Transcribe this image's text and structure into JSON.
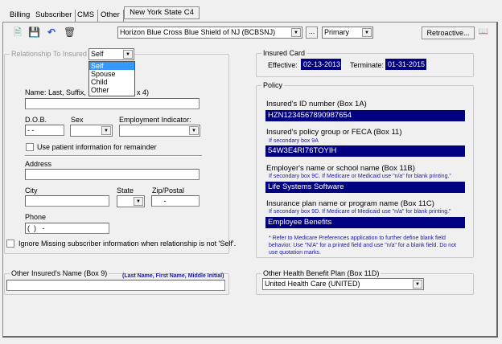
{
  "tabs": [
    {
      "label": "Billing"
    },
    {
      "label": "Subscriber"
    },
    {
      "label": "CMS"
    },
    {
      "label": "Other"
    }
  ],
  "tab_button": "New York State C4",
  "toolbar": {
    "icons": [
      "new-icon",
      "save-icon",
      "undo-icon",
      "delete-icon"
    ],
    "payer": "Horizon Blue Cross Blue Shield of NJ (BCBSNJ)",
    "browse_label": "...",
    "priority": "Primary",
    "retroactive_label": "Retroactive...",
    "copy_icon": "copy-icon"
  },
  "relationship": {
    "legend": "Relationship To Insured",
    "value": "Self",
    "options": [
      "Self",
      "Spouse",
      "Child",
      "Other"
    ]
  },
  "subscriber": {
    "name_label": "Name: Last, Suffix, F",
    "name_label_tail": "x 4)",
    "name": "",
    "dob_label": "D.O.B.",
    "dob": " - -",
    "sex_label": "Sex",
    "sex": "",
    "employment_label": "Employment Indicator:",
    "employment": "",
    "use_patient_label": "Use patient information for remainder",
    "address_label": "Address",
    "address": "",
    "city_label": "City",
    "city": "",
    "state_label": "State",
    "state": "",
    "zip_label": "Zip/Postal",
    "zip": "     -",
    "phone_label": "Phone",
    "phone": "(  )   -",
    "ignore_label": "Ignore Missing subscriber information when relationship is not 'Self'."
  },
  "other_insured": {
    "legend": "Other Insured's Name (Box 9)",
    "hint": "(Last Name, First Name, Middle Initial)",
    "value": ""
  },
  "insured_card": {
    "legend": "Insured Card",
    "effective_label": "Effective:",
    "effective": "02-13-2013",
    "terminate_label": "Terminate:",
    "terminate": "01-31-2015"
  },
  "policy": {
    "legend": "Policy",
    "id_label": "Insured's ID number (Box 1A)",
    "id": "HZN1234567890987654",
    "group_label": "Insured's policy group or FECA (Box 11)",
    "group_hint": "If secondary box 9A",
    "group": "54W3E4RI76TOYIH",
    "employer_label": "Employer's name or school name (Box 11B)",
    "employer_hint": "If secondary box 9C.  If Medicare or Medicaid use \"n/a\" for blank printing.\"",
    "employer": "Life Systems Software",
    "plan_label": "Insurance plan name or program name (Box 11C)",
    "plan_hint": "If secondary box 9D.  If Medicare of Medicaid use \"n/a\" for blank printing.\"",
    "plan": "Employee Benefits",
    "note": "* Refer to Medicare Preferences application to further define blank field behavior.  Use \"N/A\" for a printed field and use \"n/a\" for a blank field.  Do not use quotation marks."
  },
  "other_health": {
    "legend": "Other Health Benefit Plan (Box 11D)",
    "value": "United Health Care (UNITED)"
  }
}
